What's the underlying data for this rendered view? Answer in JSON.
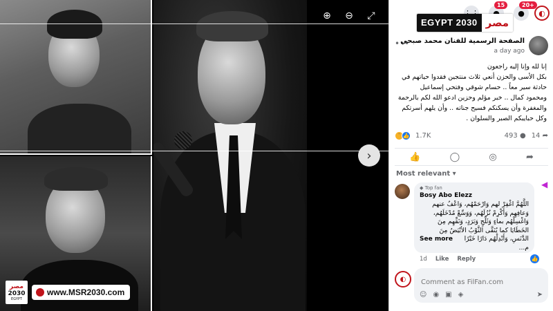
{
  "viewer": {
    "toolbar": {
      "zoom_in_icon": "zoom-in",
      "zoom_out_icon": "zoom-out",
      "fullscreen_icon": "fullscreen"
    },
    "next_icon": "chevron-right"
  },
  "watermark": {
    "logo_line1": "مصر",
    "logo_line2": "2030",
    "logo_line3": "EGYPT",
    "url": "www.MSR2030.com"
  },
  "topbar": {
    "notifications_badge": "15",
    "messages_badge": "20+"
  },
  "brand": {
    "part1": "EGYPT 2030",
    "part2": "مصر"
  },
  "post": {
    "page_name": "الصفحة الرسمية للفنان محمد صبحي",
    "time": "a day ago",
    "text_lines": [
      "إنا لله وإنا إليه راجعون",
      "بكل الأسى والحزن أنعي ثلاث منتجين فقدوا حياتهم في",
      "حادثة سير معاً .. حسام شوقي وفتحي إسماعيل",
      "ومحمود كمال .. خبر مؤلم وحزين ادعو الله لكم بالرحمة",
      "والمغفرة وأن يسكنكم فسيح جناته .. وأن يلهم أسرتكم",
      "وكل حبايبكم الصبر والسلوان ."
    ],
    "reaction_count": "1.7K",
    "comment_count": "493",
    "share_count": "14"
  },
  "comments": {
    "sort_label": "Most relevant",
    "items": [
      {
        "badge": "Top fan",
        "author": "Bosy Abo Elezz",
        "text_lines": [
          "اللَّهُمَّ اغْفِرْ لهم وَارْحَمْهُم، وَاعْفُ عنهم",
          "وَعافِهِم وَأَكْرِمْ نُزُلَهُم، وَوَسِّعْ مُدْخَلَهُم،",
          "وَاغْسِلْهُم بماءٍ وَثَلْجٍ وَبَرَدٍ، وَنَقِّهِم مِنَ",
          "الخَطَايَا كما يُنَقَّى الثَّوْبُ الأبْيَضُ مِنَ",
          "الدَّنَسِ، وَأَبْدِلْهُم دَارًا خَيْرًا م..."
        ],
        "see_more": "See more",
        "time": "1d",
        "like": "Like",
        "reply": "Reply"
      }
    ]
  },
  "composer": {
    "placeholder": "Comment as FilFan.com"
  }
}
